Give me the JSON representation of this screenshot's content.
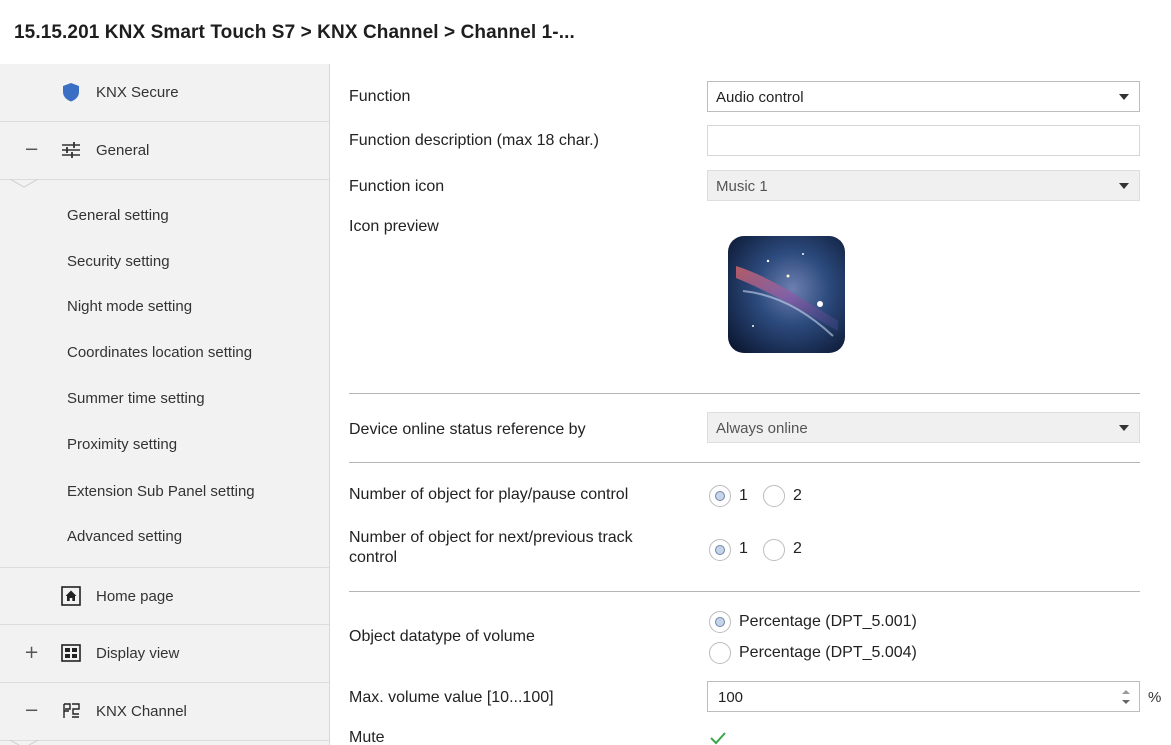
{
  "window": {
    "title": "15.15.201 KNX Smart Touch S7 > KNX Channel  > Channel 1-..."
  },
  "sidebar": {
    "knx_secure": {
      "label": "KNX Secure",
      "icon": "shield-icon"
    },
    "general": {
      "sign": "−",
      "label": "General",
      "icon": "sliders-icon"
    },
    "general_items": [
      "General setting",
      "Security setting",
      "Night mode setting",
      "Coordinates location setting",
      "Summer time setting",
      "Proximity setting",
      "Extension Sub Panel setting",
      "Advanced setting"
    ],
    "home_page": {
      "label": "Home page",
      "icon": "home-icon"
    },
    "display_view": {
      "sign": "+",
      "label": "Display view",
      "icon": "display-grid-icon"
    },
    "knx_channel": {
      "sign": "−",
      "label": "KNX Channel",
      "icon": "channel-icon"
    }
  },
  "form": {
    "function": {
      "label": "Function",
      "value": "Audio control"
    },
    "function_description": {
      "label": "Function description (max 18 char.)",
      "value": ""
    },
    "function_icon": {
      "label": "Function icon",
      "value": "Music 1"
    },
    "icon_preview": {
      "label": "Icon preview"
    },
    "online_status": {
      "label": "Device online status reference by",
      "value": "Always online"
    },
    "play_pause": {
      "label": "Number of object for play/pause control",
      "options": [
        "1",
        "2"
      ],
      "selected": "1"
    },
    "next_prev": {
      "label_line1": "Number of object for next/previous track",
      "label_line2": "control",
      "options": [
        "1",
        "2"
      ],
      "selected": "1"
    },
    "volume_datatype": {
      "label": "Object datatype of volume",
      "options": [
        "Percentage (DPT_5.001)",
        "Percentage (DPT_5.004)"
      ],
      "selected": "Percentage (DPT_5.001)"
    },
    "max_volume": {
      "label": "Max. volume value [10...100]",
      "value": "100",
      "unit": "%"
    },
    "mute": {
      "label": "Mute",
      "checked": true
    }
  },
  "colors": {
    "sidebar_bg": "#f2f2f2",
    "shield": "#3a6fc4",
    "radio_fill": "#c7d4e8",
    "check": "#3aa64a"
  }
}
